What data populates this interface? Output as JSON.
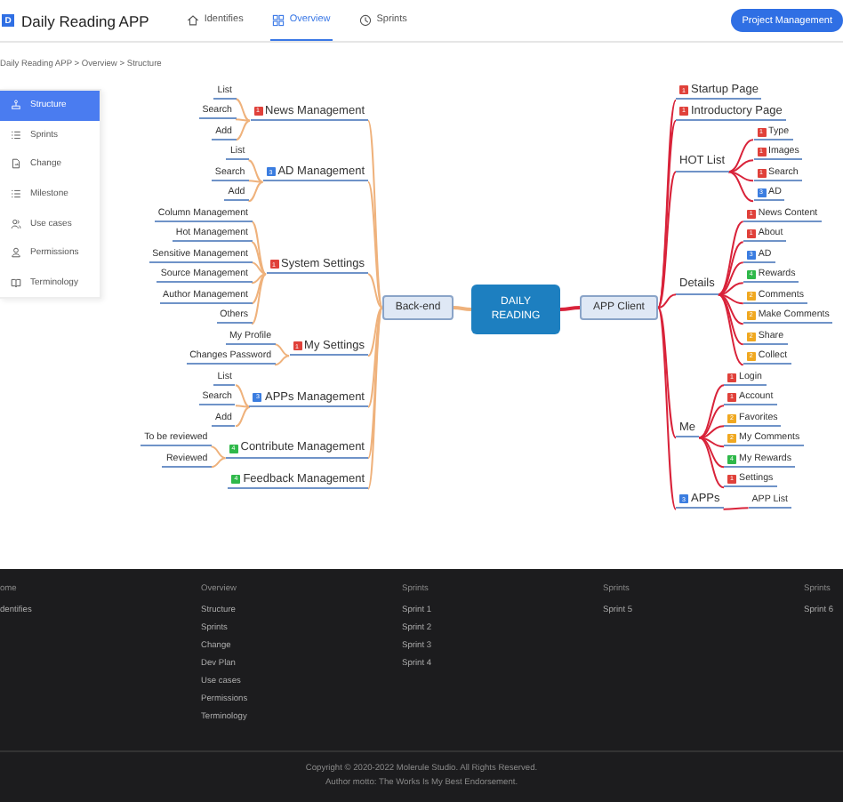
{
  "header": {
    "logo": "D",
    "title": "Daily Reading APP",
    "nav": [
      {
        "label": "Identifies",
        "kind": "home",
        "selected": false
      },
      {
        "label": "Overview",
        "kind": "grid",
        "selected": true
      },
      {
        "label": "Sprints",
        "kind": "clock",
        "selected": false
      }
    ],
    "button": "Project Management"
  },
  "breadcrumb": "Daily Reading APP > Overview > Structure",
  "sidebar": [
    {
      "label": "Structure",
      "kind": "tree",
      "selected": true
    },
    {
      "label": "Sprints",
      "kind": "list",
      "selected": false
    },
    {
      "label": "Change",
      "kind": "change",
      "selected": false
    },
    {
      "label": "Milestone",
      "kind": "list",
      "selected": false
    },
    {
      "label": "Use cases",
      "kind": "people",
      "selected": false
    },
    {
      "label": "Permissions",
      "kind": "person",
      "selected": false
    },
    {
      "label": "Terminology",
      "kind": "book",
      "selected": false
    }
  ],
  "mindmap": {
    "root": "DAILY READING",
    "left": {
      "label": "Back-end",
      "branches": [
        {
          "label": "News Management",
          "badge": {
            "text": "1",
            "color": "#e0413a"
          },
          "children": [
            {
              "label": "List"
            },
            {
              "label": "Search"
            },
            {
              "label": "Add"
            }
          ]
        },
        {
          "label": "AD Management",
          "badge": {
            "text": "3",
            "color": "#3b7de0"
          },
          "children": [
            {
              "label": "List"
            },
            {
              "label": "Search"
            },
            {
              "label": "Add"
            }
          ]
        },
        {
          "label": "System Settings",
          "badge": {
            "text": "1",
            "color": "#e0413a"
          },
          "children": [
            {
              "label": "Column Management"
            },
            {
              "label": "Hot Management"
            },
            {
              "label": "Sensitive Management"
            },
            {
              "label": "Source Management"
            },
            {
              "label": "Author Management"
            },
            {
              "label": "Others"
            }
          ]
        },
        {
          "label": "My Settings",
          "badge": {
            "text": "1",
            "color": "#e0413a"
          },
          "children": [
            {
              "label": "My Profile"
            },
            {
              "label": "Changes Password"
            }
          ]
        },
        {
          "label": "APPs Management",
          "badge": {
            "text": "3",
            "color": "#3b7de0"
          },
          "children": [
            {
              "label": "List"
            },
            {
              "label": "Search"
            },
            {
              "label": "Add"
            }
          ]
        },
        {
          "label": "Contribute Management",
          "badge": {
            "text": "4",
            "color": "#2fb84a"
          },
          "children": [
            {
              "label": "To be reviewed"
            },
            {
              "label": "Reviewed"
            }
          ]
        },
        {
          "label": "Feedback Management",
          "badge": {
            "text": "4",
            "color": "#2fb84a"
          }
        }
      ]
    },
    "right": {
      "label": "APP Client",
      "branches": [
        {
          "label": "Startup Page",
          "badge": {
            "text": "1",
            "color": "#e0413a"
          }
        },
        {
          "label": "Introductory Page",
          "badge": {
            "text": "1",
            "color": "#e0413a"
          }
        },
        {
          "label": "HOT List",
          "children": [
            {
              "label": "Type",
              "badge": {
                "text": "1",
                "color": "#e0413a"
              }
            },
            {
              "label": "Images",
              "badge": {
                "text": "1",
                "color": "#e0413a"
              }
            },
            {
              "label": "Search",
              "badge": {
                "text": "1",
                "color": "#e0413a"
              }
            },
            {
              "label": "AD",
              "badge": {
                "text": "3",
                "color": "#3b7de0"
              }
            }
          ]
        },
        {
          "label": "Details",
          "children": [
            {
              "label": "News Content",
              "badge": {
                "text": "1",
                "color": "#e0413a"
              }
            },
            {
              "label": "About",
              "badge": {
                "text": "1",
                "color": "#e0413a"
              }
            },
            {
              "label": "AD",
              "badge": {
                "text": "3",
                "color": "#3b7de0"
              }
            },
            {
              "label": "Rewards",
              "badge": {
                "text": "4",
                "color": "#2fb84a"
              }
            },
            {
              "label": "Comments",
              "badge": {
                "text": "2",
                "color": "#f0a820"
              }
            },
            {
              "label": "Make Comments",
              "badge": {
                "text": "2",
                "color": "#f0a820"
              }
            },
            {
              "label": "Share",
              "badge": {
                "text": "2",
                "color": "#f0a820"
              }
            },
            {
              "label": "Collect",
              "badge": {
                "text": "2",
                "color": "#f0a820"
              }
            }
          ]
        },
        {
          "label": "Me",
          "children": [
            {
              "label": "Login",
              "badge": {
                "text": "1",
                "color": "#e0413a"
              }
            },
            {
              "label": "Account",
              "badge": {
                "text": "1",
                "color": "#e0413a"
              }
            },
            {
              "label": "Favorites",
              "badge": {
                "text": "2",
                "color": "#f0a820"
              }
            },
            {
              "label": "My Comments",
              "badge": {
                "text": "2",
                "color": "#f0a820"
              }
            },
            {
              "label": "My Rewards",
              "badge": {
                "text": "4",
                "color": "#2fb84a"
              }
            },
            {
              "label": "Settings",
              "badge": {
                "text": "1",
                "color": "#e0413a"
              }
            }
          ]
        },
        {
          "label": "APPs",
          "badge": {
            "text": "3",
            "color": "#3b7de0"
          },
          "children": [
            {
              "label": "APP List"
            }
          ]
        }
      ]
    }
  },
  "footer": {
    "columns": [
      [
        "ome",
        "dentifies"
      ],
      [
        "Overview",
        "Structure",
        "Sprints",
        "Change",
        "Dev Plan",
        "Use cases",
        "Permissions",
        "Terminology"
      ],
      [
        "Sprints",
        "Sprint 1",
        "Sprint 2",
        "Sprint 3",
        "Sprint 4"
      ],
      [
        "Sprints",
        "Sprint 5"
      ],
      [
        "Sprints",
        "Sprint 6"
      ]
    ],
    "copyright": "Copyright © 2020-2022 Molerule Studio. All Rights Reserved.",
    "motto": "Author motto: The Works Is My Best Endorsement."
  }
}
